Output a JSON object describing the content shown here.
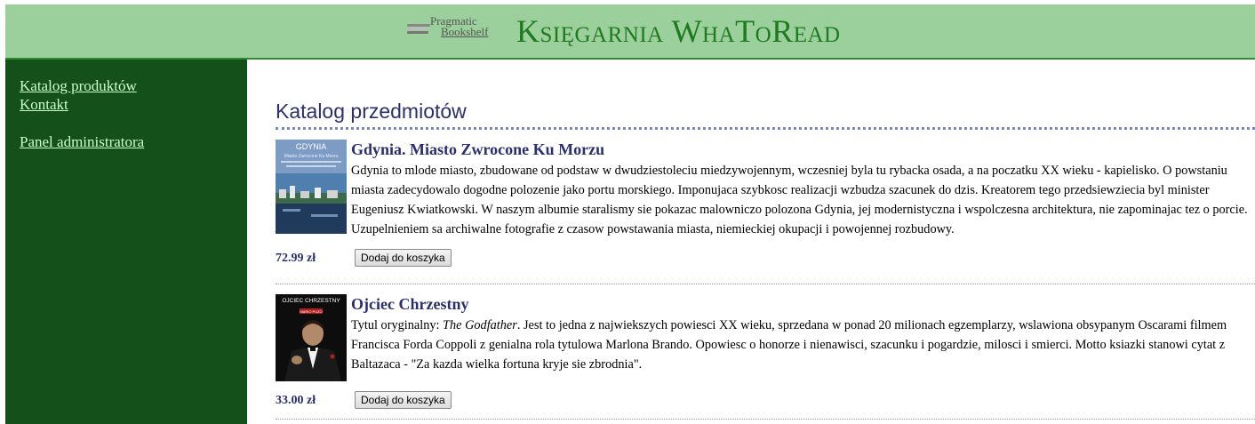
{
  "header": {
    "logo": {
      "line1": "Pragmatic",
      "line2": "Bookshelf"
    },
    "title": "Księgarnia WhaToRead"
  },
  "sidebar": {
    "items": [
      {
        "label": "Katalog produktów"
      },
      {
        "label": "Kontakt"
      },
      {
        "label": "Panel administratora"
      }
    ]
  },
  "main": {
    "heading": "Katalog przedmiotów",
    "products": [
      {
        "title": "Gdynia. Miasto Zwrocone Ku Morzu",
        "description": "Gdynia to mlode miasto, zbudowane od podstaw w dwudziestoleciu miedzywojennym, wczesniej byla tu rybacka osada, a na poczatku XX wieku - kapielisko. O powstaniu miasta zadecydowalo dogodne polozenie jako portu morskiego. Imponujaca szybkosc realizacji wzbudza szacunek do dzis. Kreatorem tego przedsiewziecia byl minister Eugeniusz Kwiatkowski. W naszym albumie staralismy sie pokazac malowniczo polozona Gdynia, jej modernistyczna i wspolczesna architektura, nie zapominajac tez o porcie. Uzupelnieniem sa archiwalne fotografie z czasow powstawania miasta, niemieckiej okupacji i powojennej rozbudowy.",
        "price": "72.99 zł",
        "button": "Dodaj do koszyka",
        "cover": {
          "title": "GDYNIA",
          "subtitle": "Miasto Zwrocone Ku Morzu"
        }
      },
      {
        "title": "Ojciec Chrzestny",
        "desc_prefix": "Tytul oryginalny: ",
        "desc_italic": "The Godfather",
        "desc_rest": ". Jest to jedna z najwiekszych powiesci XX wieku, sprzedana w ponad 20 milionach egzemplarzy, wslawiona obsypanym Oscarami filmem Francisca Forda Coppoli z genialna rola tytulowa Marlona Brando. Opowiesc o honorze i nienawisci, szacunku i pogardzie, milosci i smierci. Motto ksiazki stanowi cytat z Baltazaca - \"Za kazda wielka fortuna kryje sie zbrodnia\".",
        "price": "33.00 zł",
        "button": "Dodaj do koszyka",
        "cover": {
          "title": "OJCIEC CHRZESTNY",
          "author": "MARIO PUZO"
        }
      }
    ]
  },
  "colors": {
    "banner": "#9bcf9b",
    "title": "#1e7a1e",
    "sidebar": "#14501a",
    "link": "#ccffcc",
    "heading": "#2a2f6e"
  }
}
